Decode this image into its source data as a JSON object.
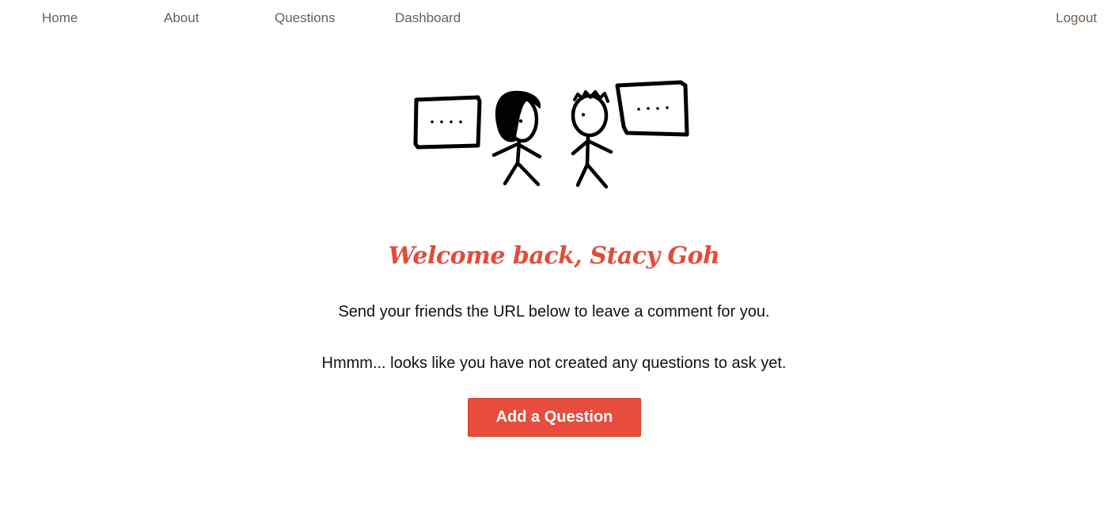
{
  "nav": {
    "home": "Home",
    "about": "About",
    "questions": "Questions",
    "dashboard": "Dashboard",
    "logout": "Logout"
  },
  "illustration": {
    "left_bubble_text": "....",
    "right_bubble_text": "...."
  },
  "main": {
    "welcome": "Welcome back, Stacy Goh",
    "share_message": "Send your friends the URL below to leave a comment for you.",
    "empty_message": "Hmmm... looks like you have not created any questions to ask yet.",
    "add_button_label": "Add a Question"
  },
  "colors": {
    "accent": "#e74c3c",
    "nav_text": "#6b5e55"
  }
}
